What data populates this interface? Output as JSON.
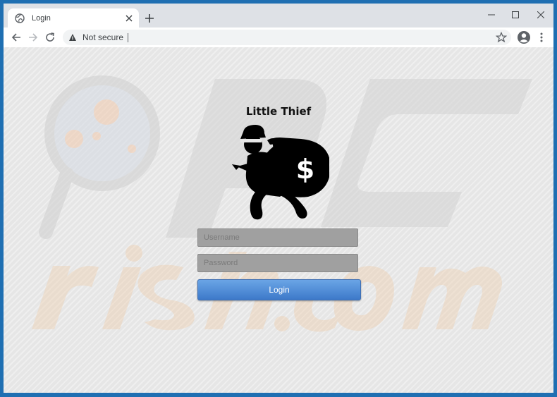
{
  "browser": {
    "tab_title": "Login",
    "security_label": "Not secure",
    "icons": {
      "tab_favicon": "globe-icon",
      "tab_close": "close-icon",
      "new_tab": "plus-icon",
      "minimize": "minimize-icon",
      "maximize": "maximize-icon",
      "close_window": "close-icon",
      "back": "arrow-left-icon",
      "forward": "arrow-right-icon",
      "reload": "reload-icon",
      "security": "warning-triangle-icon",
      "bookmark": "star-icon",
      "profile": "account-circle-icon",
      "menu": "kebab-menu-icon"
    }
  },
  "page": {
    "site_title": "Little Thief",
    "logo_icon": "thief-with-money-bag-icon",
    "username_placeholder": "Username",
    "password_placeholder": "Password",
    "login_label": "Login",
    "colors": {
      "login_button": "#4a87d6",
      "field_background": "#a0a0a0",
      "window_frame": "#1f6fb2"
    }
  }
}
